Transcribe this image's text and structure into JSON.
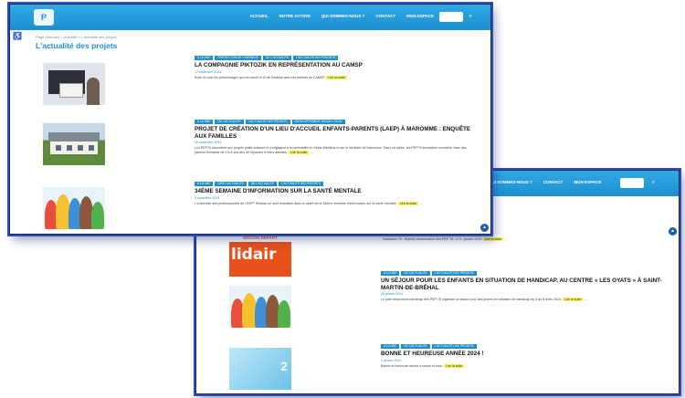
{
  "page": {
    "title": "L'actualité des projets",
    "breadcrumb": "Page d'accueil > Actualité > L'actualité des projets"
  },
  "colors": {
    "accent": "#1d8fd1",
    "highlight": "#f7f45a",
    "frame": "#2f4fb0"
  },
  "nav": {
    "items": [
      "Accueil",
      "Notre action",
      "Qui sommes-nous ?",
      "Contact",
      "Mon espace"
    ],
    "search_icon": "search-icon"
  },
  "shot2_nav": {
    "items": [
      "Qui sommes-nous ?",
      "Contact",
      "Mon espace"
    ]
  },
  "articles_top": [
    {
      "tags": [
        "À LA UNE",
        "PROTECTION DE L'ENFANCE",
        "DE L'ACTUALITÉ",
        "L'ACTUALITÉ DES PROJETS"
      ],
      "title": "La compagnie Piktozik en représentation au CAMSP",
      "date": "17 novembre 2023",
      "excerpt": "Suite et voici les personnages qui ont ouvert le fil de l'histoire avec les enfants au CAMSP.",
      "more": "Lire la suite",
      "image": "video-image"
    },
    {
      "tags": [
        "À LA UNE",
        "DE L'ACTUALITÉ",
        "L'ACTUALITÉ DES PROJETS",
        "DÉVELOPPEMENT SOCIAL LOCAL"
      ],
      "title": "Projet de création d'un lieu d'accueil enfants-parents (LAEP) à Maromme : enquête aux familles",
      "date": "20 novembre 2023",
      "excerpt": "Les PEP76 répondent aux projets petite enfance et s'engagent à la parentalité en Seine-Maritime et sur le territoire de Maromme. Dans ce cadre, les PEP76 souhaitent connaître l'avis des parents d'enfants de 0 à 6 ans afin de répondre à leurs attentes.",
      "more": "Lire la suite",
      "image": "house-image"
    },
    {
      "tags": [
        "À LA UNE",
        "DIRE L'ACTUALITÉ",
        "DE L'ACTUALITÉ",
        "L'ACTUALITÉ DES PROJETS"
      ],
      "title": "34ème semaine d'information sur la santé mentale",
      "date": "9 novembre 2023",
      "excerpt": "L'ensemble des professionnels de l'ESPT Réseau se sont mobilisés dans le cadre de la 34ème semaine d'information sur la santé mentale.",
      "more": "Lire la suite",
      "image": "kids-image"
    }
  ],
  "articles_bottom": [
    {
      "image": "solidair-image",
      "image_banner": "ÉDITION DÉPART",
      "image_word": "lidair",
      "excerpt": "Solidaires 76 - Bulletin d'information des PEP 76 - n°3 - janvier 2024",
      "more": "Lire la suite"
    },
    {
      "tags": [
        "À LA UNE",
        "DE L'ACTUALITÉ",
        "L'ACTUALITÉ DES PROJETS"
      ],
      "title": "Un séjour pour les enfants en situation de handicap, au centre « Les Oyats » à Saint-Martin-de-Bréhal",
      "date": "25 janvier 2024",
      "excerpt": "Le pôle ressources handicap des PEP 76 organise un séjour pour des jeunes en situation de handicap du 4 au 8 mars 2024.",
      "more": "Lire la suite",
      "image": "kids-image"
    },
    {
      "tags": [
        "À LA UNE",
        "DE L'ACTUALITÉ",
        "L'ACTUALITÉ DES PROJETS"
      ],
      "title": "Bonne et heureuse année 2024 !",
      "date": "2 janvier 2024",
      "excerpt": "Bonne et heureuse année à toutes et tous.",
      "more": "Lire la suite",
      "image": "blue-image",
      "image_word": "2"
    }
  ]
}
